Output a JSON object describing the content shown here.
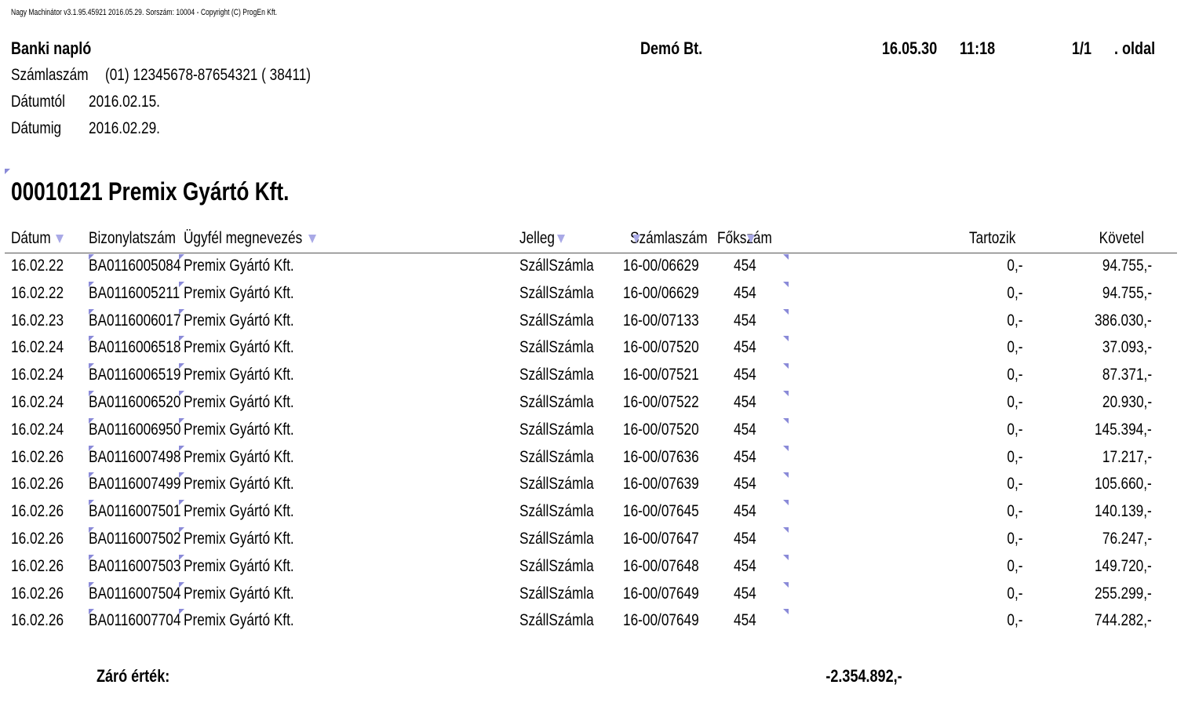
{
  "copyright": "Nagy Machinátor v3.1.95.45921 2016.05.29. Sorszám: 10004 - Copyright (C) ProgEn Kft.",
  "header": {
    "report_title": "Banki napló",
    "company": "Demó Bt.",
    "date": "16.05.30",
    "time": "11:18",
    "page": "1/1",
    "page_suffix": ". oldal"
  },
  "meta": {
    "account_label": "Számlaszám",
    "account_value": "(01) 12345678-87654321 ( 38411)",
    "from_label": "Dátumtól",
    "from_value": "2016.02.15.",
    "to_label": "Dátumig",
    "to_value": "2016.02.29."
  },
  "group_title": "00010121 Premix Gyártó Kft.",
  "columns": {
    "date": "Dátum",
    "doc": "Bizonylatszám",
    "client": "Ügyfél megnevezés",
    "type": "Jelleg",
    "invoice": "Számlaszám",
    "ledger": "Főkszám",
    "debit": "Tartozik",
    "credit": "Követel"
  },
  "rows": [
    {
      "date": "16.02.22",
      "doc": "BA0116005084",
      "client": "Premix Gyártó Kft.",
      "type": "SzállSzámla",
      "invoice": "16-00/06629",
      "ledger": "454",
      "debit": "0,-",
      "credit": "94.755,-"
    },
    {
      "date": "16.02.22",
      "doc": "BA0116005211",
      "client": "Premix Gyártó Kft.",
      "type": "SzállSzámla",
      "invoice": "16-00/06629",
      "ledger": "454",
      "debit": "0,-",
      "credit": "94.755,-"
    },
    {
      "date": "16.02.23",
      "doc": "BA0116006017",
      "client": "Premix Gyártó Kft.",
      "type": "SzállSzámla",
      "invoice": "16-00/07133",
      "ledger": "454",
      "debit": "0,-",
      "credit": "386.030,-"
    },
    {
      "date": "16.02.24",
      "doc": "BA0116006518",
      "client": "Premix Gyártó Kft.",
      "type": "SzállSzámla",
      "invoice": "16-00/07520",
      "ledger": "454",
      "debit": "0,-",
      "credit": "37.093,-"
    },
    {
      "date": "16.02.24",
      "doc": "BA0116006519",
      "client": "Premix Gyártó Kft.",
      "type": "SzállSzámla",
      "invoice": "16-00/07521",
      "ledger": "454",
      "debit": "0,-",
      "credit": "87.371,-"
    },
    {
      "date": "16.02.24",
      "doc": "BA0116006520",
      "client": "Premix Gyártó Kft.",
      "type": "SzállSzámla",
      "invoice": "16-00/07522",
      "ledger": "454",
      "debit": "0,-",
      "credit": "20.930,-"
    },
    {
      "date": "16.02.24",
      "doc": "BA0116006950",
      "client": "Premix Gyártó Kft.",
      "type": "SzállSzámla",
      "invoice": "16-00/07520",
      "ledger": "454",
      "debit": "0,-",
      "credit": "145.394,-"
    },
    {
      "date": "16.02.26",
      "doc": "BA0116007498",
      "client": "Premix Gyártó Kft.",
      "type": "SzállSzámla",
      "invoice": "16-00/07636",
      "ledger": "454",
      "debit": "0,-",
      "credit": "17.217,-"
    },
    {
      "date": "16.02.26",
      "doc": "BA0116007499",
      "client": "Premix Gyártó Kft.",
      "type": "SzállSzámla",
      "invoice": "16-00/07639",
      "ledger": "454",
      "debit": "0,-",
      "credit": "105.660,-"
    },
    {
      "date": "16.02.26",
      "doc": "BA0116007501",
      "client": "Premix Gyártó Kft.",
      "type": "SzállSzámla",
      "invoice": "16-00/07645",
      "ledger": "454",
      "debit": "0,-",
      "credit": "140.139,-"
    },
    {
      "date": "16.02.26",
      "doc": "BA0116007502",
      "client": "Premix Gyártó Kft.",
      "type": "SzállSzámla",
      "invoice": "16-00/07647",
      "ledger": "454",
      "debit": "0,-",
      "credit": "76.247,-"
    },
    {
      "date": "16.02.26",
      "doc": "BA0116007503",
      "client": "Premix Gyártó Kft.",
      "type": "SzállSzámla",
      "invoice": "16-00/07648",
      "ledger": "454",
      "debit": "0,-",
      "credit": "149.720,-"
    },
    {
      "date": "16.02.26",
      "doc": "BA0116007504",
      "client": "Premix Gyártó Kft.",
      "type": "SzállSzámla",
      "invoice": "16-00/07649",
      "ledger": "454",
      "debit": "0,-",
      "credit": "255.299,-"
    },
    {
      "date": "16.02.26",
      "doc": "BA0116007704",
      "client": "Premix Gyártó Kft.",
      "type": "SzállSzámla",
      "invoice": "16-00/07649",
      "ledger": "454",
      "debit": "0,-",
      "credit": "744.282,-"
    }
  ],
  "footer": {
    "closing_label": "Záró érték:",
    "closing_value": "-2.354.892,-"
  },
  "colors": {
    "marker": "#8a8ad8",
    "filter_icon": "#a9a9e6"
  }
}
